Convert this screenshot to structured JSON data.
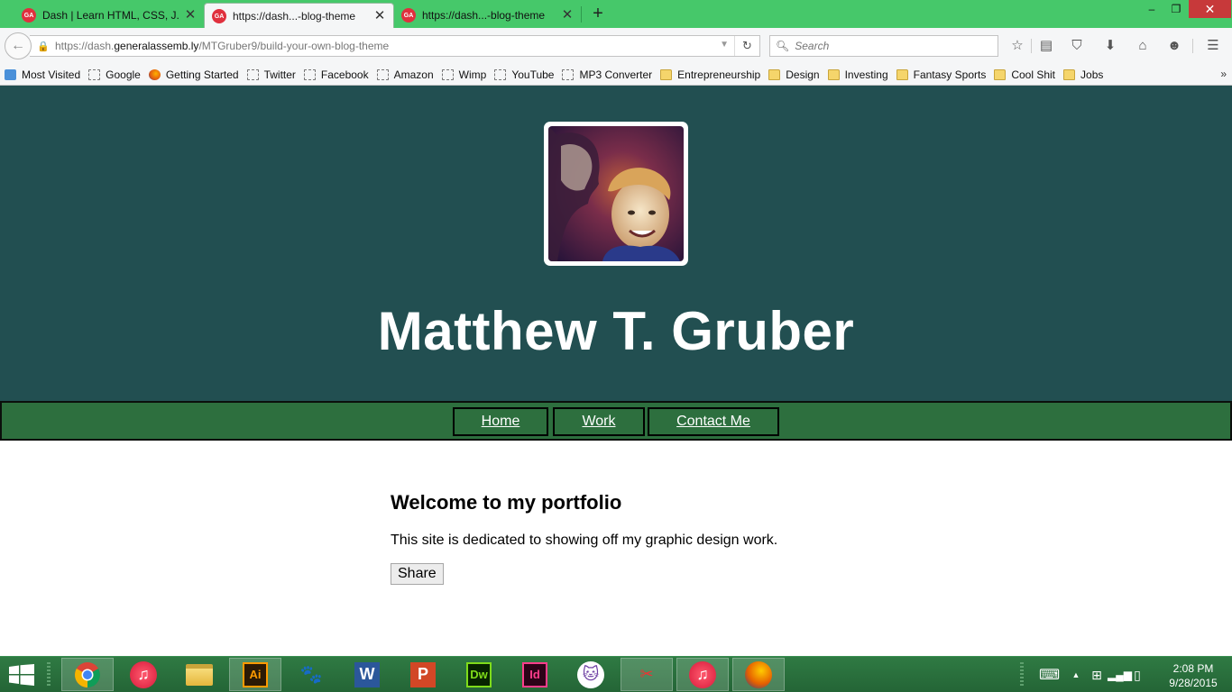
{
  "browser": {
    "tabs": [
      {
        "label": "Dash | Learn HTML, CSS, J...",
        "favicon": "GA",
        "active": false
      },
      {
        "label": "https://dash...-blog-theme",
        "favicon": "GA",
        "active": true
      },
      {
        "label": "https://dash...-blog-theme",
        "favicon": "GA",
        "active": false
      }
    ],
    "new_tab_glyph": "+",
    "window_controls": {
      "minimize": "–",
      "restore": "❐",
      "close": "✕"
    },
    "url": {
      "prefix": "https://dash.",
      "domain": "generalassemb.ly",
      "path": "/MTGruber9/build-your-own-blog-theme"
    },
    "search_placeholder": "Search",
    "toolbar_icons": [
      "star-icon",
      "reading-list-icon",
      "pocket-icon",
      "download-icon",
      "home-icon",
      "hello-icon",
      "menu-icon"
    ],
    "bookmarks": [
      {
        "label": "Most Visited",
        "icon": "most-visited"
      },
      {
        "label": "Google",
        "icon": "blank"
      },
      {
        "label": "Getting Started",
        "icon": "firefox"
      },
      {
        "label": "Twitter",
        "icon": "blank"
      },
      {
        "label": "Facebook",
        "icon": "blank"
      },
      {
        "label": "Amazon",
        "icon": "blank"
      },
      {
        "label": "Wimp",
        "icon": "blank"
      },
      {
        "label": "YouTube",
        "icon": "blank"
      },
      {
        "label": "MP3 Converter",
        "icon": "blank"
      },
      {
        "label": "Entrepreneurship",
        "icon": "folder"
      },
      {
        "label": "Design",
        "icon": "folder"
      },
      {
        "label": "Investing",
        "icon": "folder"
      },
      {
        "label": "Fantasy Sports",
        "icon": "folder"
      },
      {
        "label": "Cool Shit",
        "icon": "folder"
      },
      {
        "label": "Jobs",
        "icon": "folder"
      }
    ],
    "bookmarks_overflow": "»"
  },
  "page": {
    "site_title": "Matthew T. Gruber",
    "nav": [
      {
        "label": "Home"
      },
      {
        "label": "Work"
      },
      {
        "label": "Contact Me"
      }
    ],
    "heading": "Welcome to my portfolio",
    "intro": "This site is dedicated to showing off my graphic design work.",
    "share_label": "Share",
    "colors": {
      "header_bg": "#224f51",
      "nav_bg": "#2d6f3e",
      "title": "#ffffff"
    }
  },
  "taskbar": {
    "apps": [
      "chrome",
      "itunes",
      "file-explorer",
      "illustrator",
      "gimp",
      "word",
      "powerpoint",
      "dreamweaver",
      "indesign",
      "github",
      "snipping-tool",
      "itunes",
      "firefox"
    ],
    "app_labels": {
      "illustrator": "Ai",
      "word": "W",
      "powerpoint": "P",
      "dreamweaver": "Dw",
      "indesign": "Id"
    },
    "clock_time": "2:08 PM",
    "clock_date": "9/28/2015"
  }
}
